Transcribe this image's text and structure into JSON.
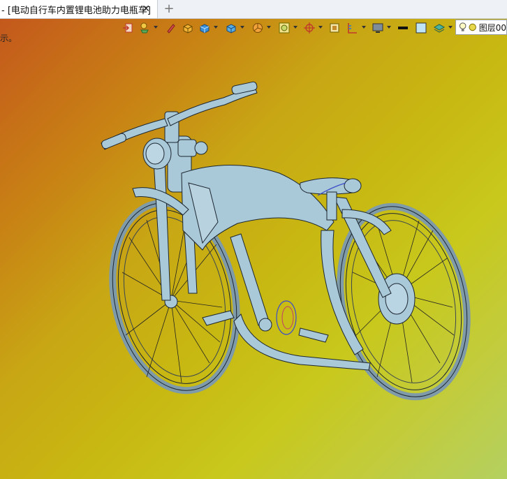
{
  "tab": {
    "title": "- [电动自行车内置锂电池助力电瓶车]",
    "close": "✕",
    "new_tab": "+"
  },
  "viewport": {
    "hint": "示。"
  },
  "toolbar": {
    "icons": [
      "exit-icon",
      "light-bulb-icon",
      "pen-icon",
      "box-solid-icon",
      "box-blue-icon",
      "box-grid-icon",
      "pie-icon",
      "view-cube-icon",
      "axis-icon",
      "frame-icon",
      "ruler-icon",
      "monitor-icon",
      "line-icon",
      "square-color-icon",
      "layers-icon"
    ]
  },
  "layer": {
    "label": "图层00"
  },
  "colors": {
    "model": "#a9c8d8",
    "edge": "#1c2630",
    "accent": "#3b4cc9"
  }
}
